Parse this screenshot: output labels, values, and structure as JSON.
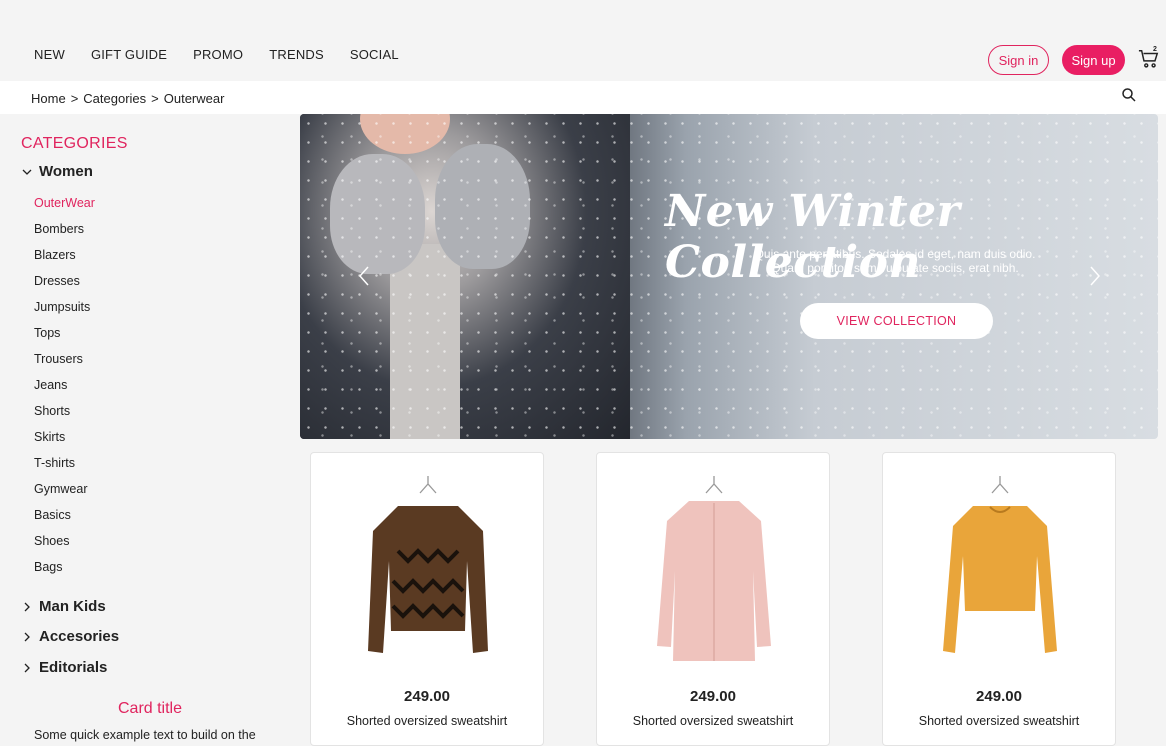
{
  "nav": {
    "links": [
      "NEW",
      "GIFT GUIDE",
      "PROMO",
      "TRENDS",
      "SOCIAL"
    ],
    "sign_in": "Sign in",
    "sign_up": "Sign up",
    "cart_count": "2",
    "accent_color": "#e91e63"
  },
  "breadcrumb": [
    "Home",
    "Categories",
    "Outerwear"
  ],
  "sidebar": {
    "title": "CATEGORIES",
    "women": "Women",
    "women_items": [
      "OuterWear",
      "Bombers",
      "Blazers",
      "Dresses",
      "Jumpsuits",
      "Tops",
      "Trousers",
      "Jeans",
      "Shorts",
      "Skirts",
      "T-shirts",
      "Gymwear",
      "Basics",
      "Shoes",
      "Bags"
    ],
    "active_item": "OuterWear",
    "groups": [
      "Man Kids",
      "Accesories",
      "Editorials"
    ],
    "card_title": "Card title",
    "card_text": "Some quick example text to build on the"
  },
  "hero": {
    "title": "New Winter Collection",
    "subtitle_line1": "Quis ante penatibus. Sodales id eget, nam duis odio.",
    "subtitle_line2": "Quam porttitor, sem vulputate sociis, erat nibh.",
    "button": "VIEW COLLECTION"
  },
  "products": [
    {
      "price": "249.00",
      "name": "Shorted oversized sweatshirt",
      "color": "#5a3a22"
    },
    {
      "price": "249.00",
      "name": "Shorted oversized sweatshirt",
      "color": "#efc3bd"
    },
    {
      "price": "249.00",
      "name": "Shorted oversized sweatshirt",
      "color": "#e9a53a"
    }
  ]
}
